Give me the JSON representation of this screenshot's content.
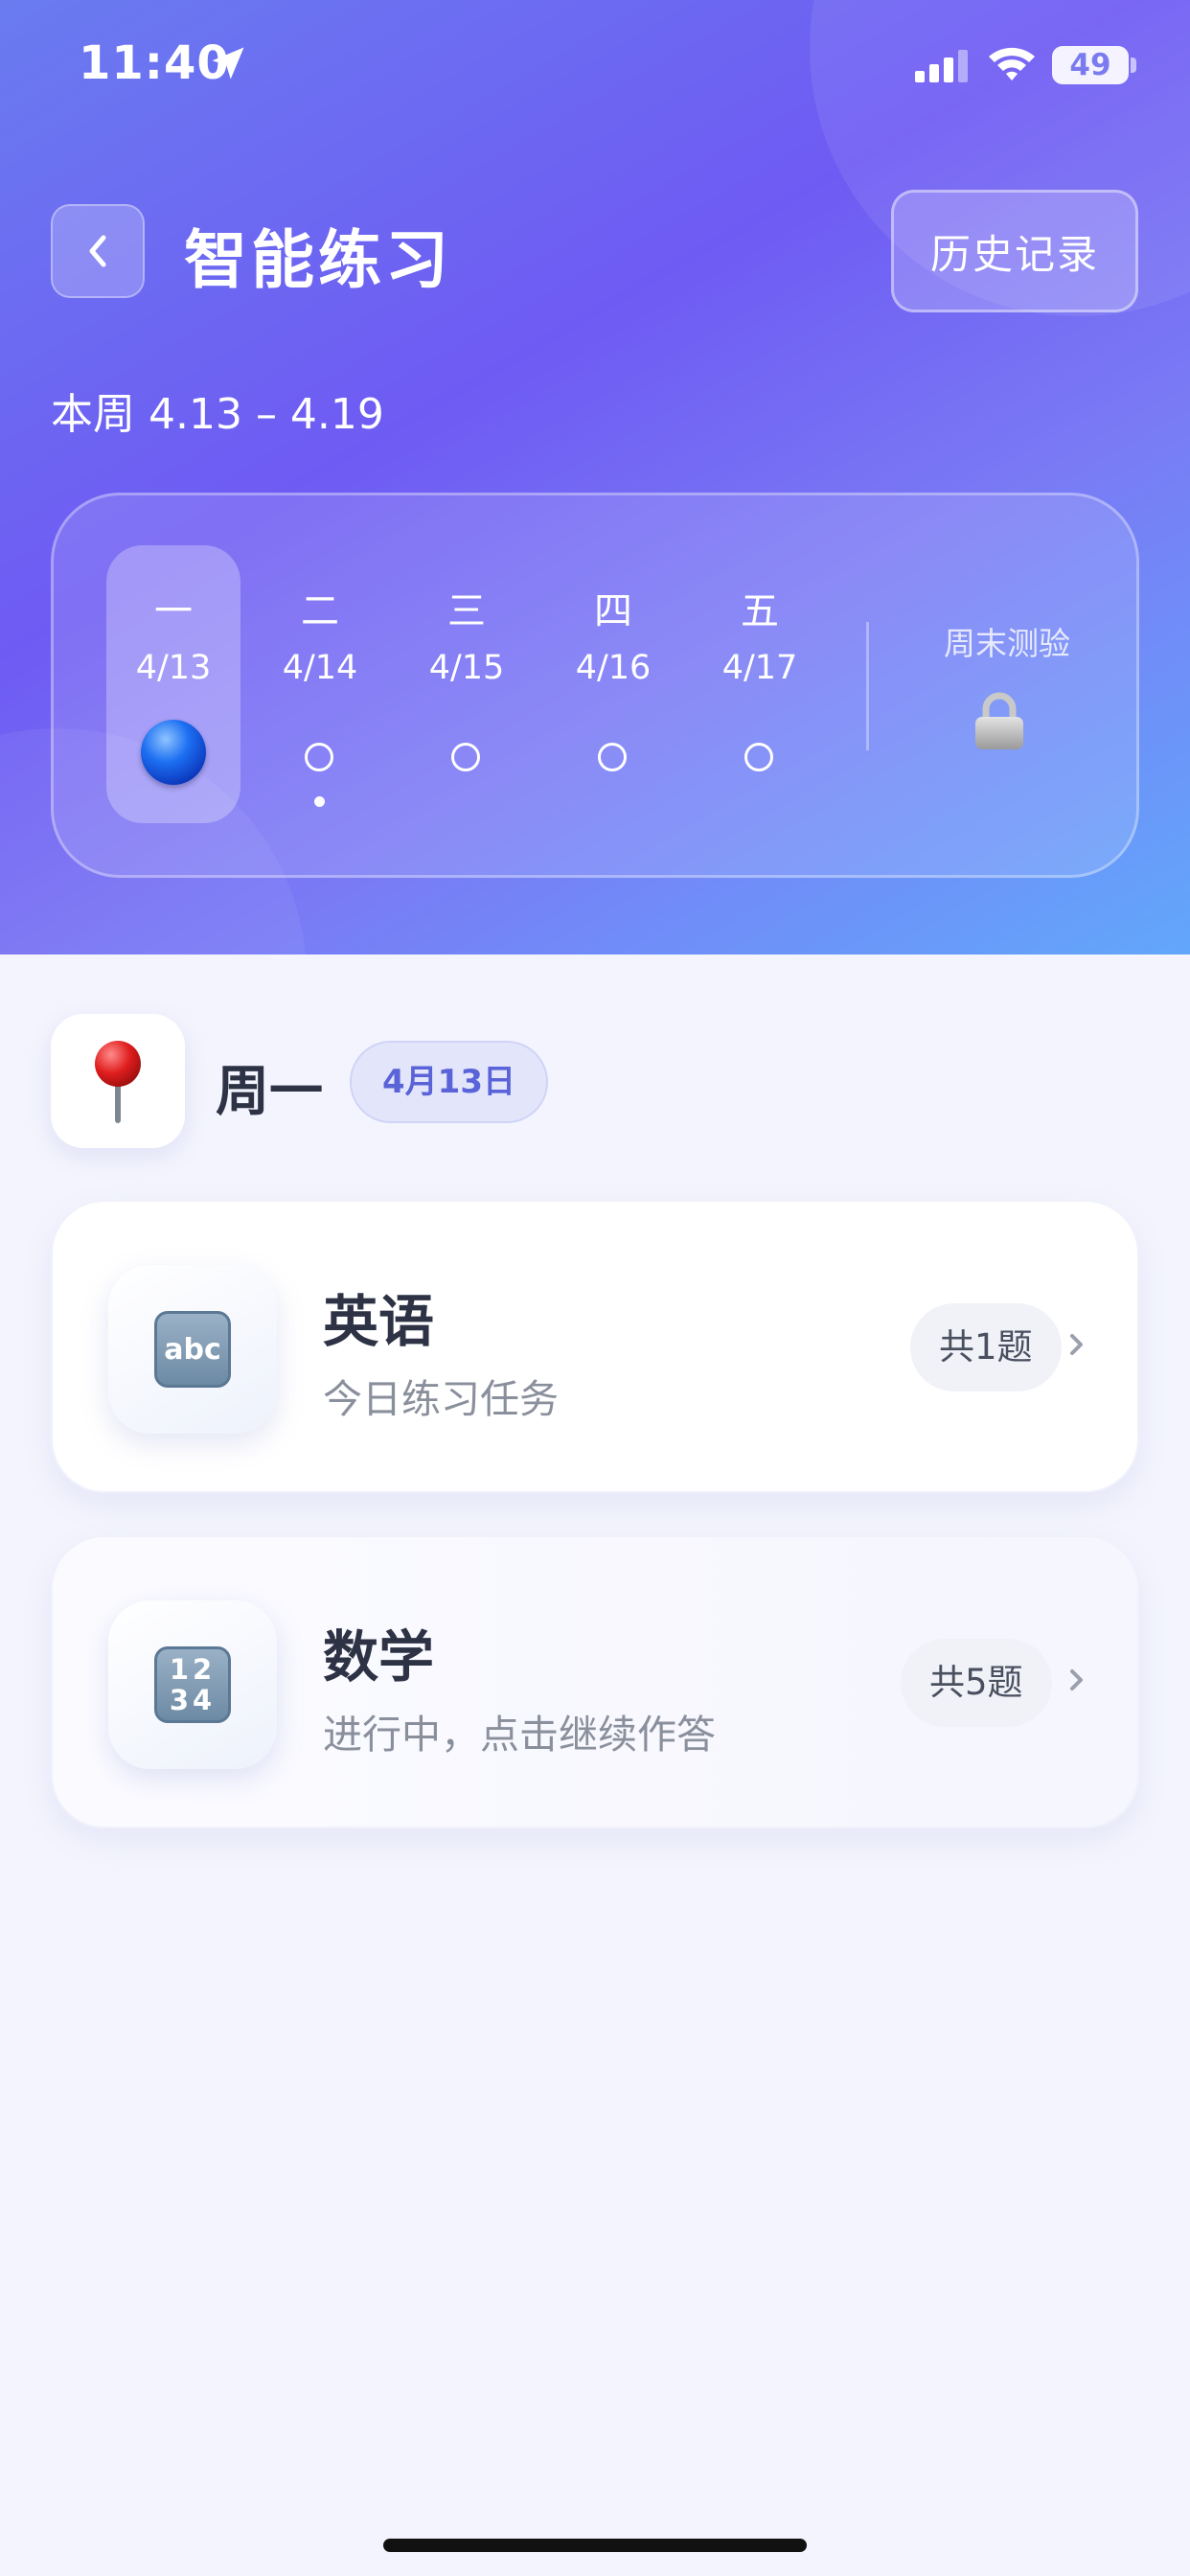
{
  "status_bar": {
    "time": "11:40",
    "battery": "49"
  },
  "header": {
    "title": "智能练习",
    "history_label": "历史记录",
    "week_range": "本周 4.13 – 4.19"
  },
  "week": {
    "days": [
      {
        "weekday": "一",
        "date": "4/13",
        "state": "active"
      },
      {
        "weekday": "二",
        "date": "4/14",
        "state": "today-marker"
      },
      {
        "weekday": "三",
        "date": "4/15",
        "state": "open"
      },
      {
        "weekday": "四",
        "date": "4/16",
        "state": "open"
      },
      {
        "weekday": "五",
        "date": "4/17",
        "state": "open"
      }
    ],
    "weekend_label": "周末测验"
  },
  "selected_day": {
    "name": "周一",
    "date_chip": "4月13日"
  },
  "subjects": [
    {
      "name": "英语",
      "desc": "今日练习任务",
      "count": "共1题",
      "icon": "abc-key-icon",
      "icon_text": "abc"
    },
    {
      "name": "数学",
      "desc": "进行中，点击继续作答",
      "count": "共5题",
      "icon": "numbers-key-icon",
      "icon_text_1": "12",
      "icon_text_2": "34"
    }
  ],
  "colors": {
    "accent": "#6e5bf3",
    "hero_end": "#62a7fb",
    "chip_text": "#5a63d7",
    "background": "#f3f4fd"
  }
}
